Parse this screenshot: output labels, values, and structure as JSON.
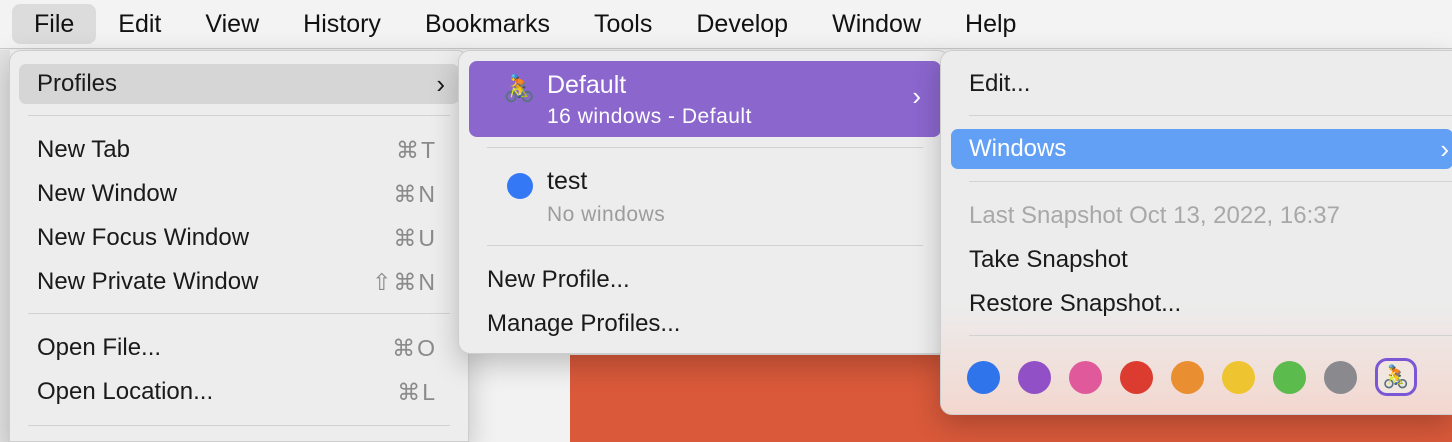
{
  "menubar": {
    "items": [
      "File",
      "Edit",
      "View",
      "History",
      "Bookmarks",
      "Tools",
      "Develop",
      "Window",
      "Help"
    ],
    "open_item": "File"
  },
  "file_menu": {
    "profiles_label": "Profiles",
    "items": [
      {
        "label": "New Tab",
        "shortcut": "⌘T"
      },
      {
        "label": "New Window",
        "shortcut": "⌘N"
      },
      {
        "label": "New Focus Window",
        "shortcut": "⌘U"
      },
      {
        "label": "New Private Window",
        "shortcut": "⇧⌘N"
      },
      {
        "label": "Open File...",
        "shortcut": "⌘O"
      },
      {
        "label": "Open Location...",
        "shortcut": "⌘L"
      }
    ]
  },
  "profiles_menu": {
    "default": {
      "icon": "🚴",
      "name": "Default",
      "subtitle": "16 windows - Default",
      "highlight_color": "#8a66cd"
    },
    "test": {
      "name": "test",
      "subtitle": "No windows",
      "dot_color": "#3478f6"
    },
    "new_profile": "New Profile...",
    "manage_profiles": "Manage Profiles..."
  },
  "profile_submenu": {
    "edit": "Edit...",
    "windows": "Windows",
    "last_snapshot": "Last Snapshot Oct 13, 2022, 16:37",
    "take_snapshot": "Take Snapshot",
    "restore_snapshot": "Restore Snapshot...",
    "highlight_color": "#62a0f5",
    "colors": [
      "#2f74ea",
      "#9250c6",
      "#e05a9b",
      "#dc3b2f",
      "#ea8e32",
      "#efc431",
      "#5cbb4d",
      "#8a8a8e"
    ],
    "selected_icon": "🚴"
  }
}
